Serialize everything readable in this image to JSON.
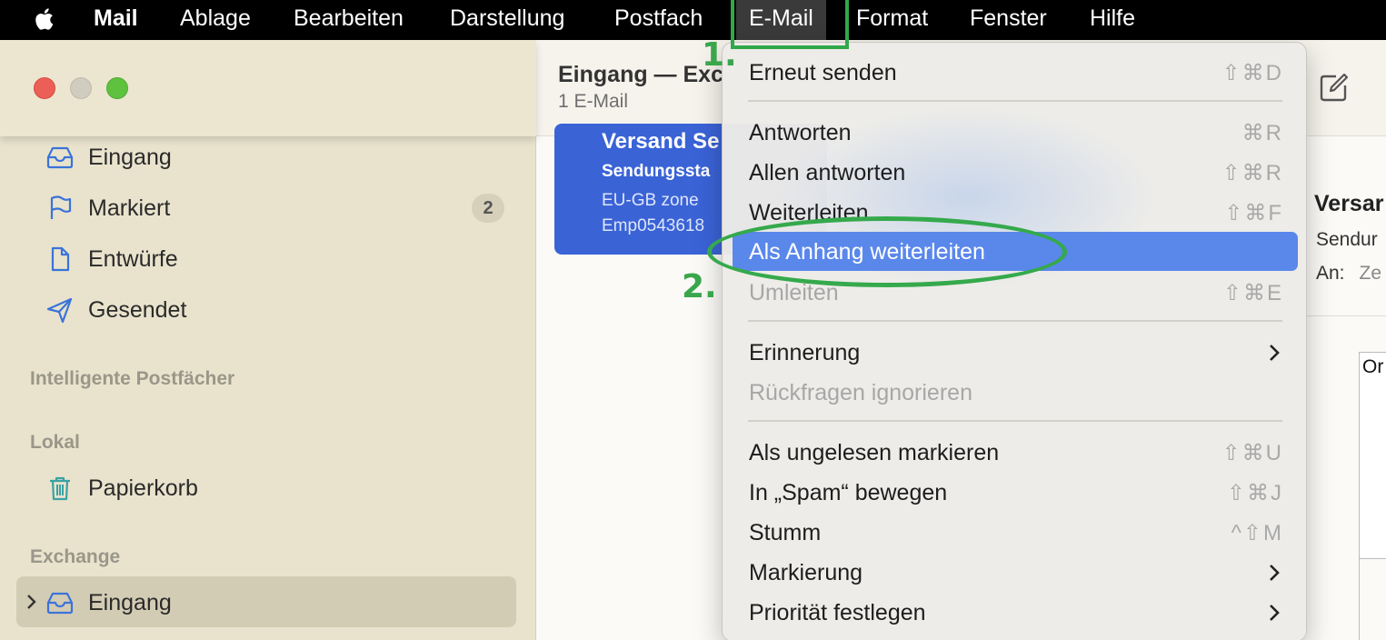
{
  "menubar": {
    "app": "Mail",
    "items": [
      "Ablage",
      "Bearbeiten",
      "Darstellung",
      "Postfach",
      "E-Mail",
      "Format",
      "Fenster",
      "Hilfe"
    ],
    "active": "E-Mail"
  },
  "annotations": {
    "step1": "1.",
    "step2": "2.",
    "accent": "#2fa84a"
  },
  "sidebar": {
    "items": [
      {
        "label": "Eingang",
        "icon": "inbox-icon"
      },
      {
        "label": "Markiert",
        "icon": "flag-icon",
        "badge": "2"
      },
      {
        "label": "Entwürfe",
        "icon": "document-icon"
      },
      {
        "label": "Gesendet",
        "icon": "paperplane-icon"
      }
    ],
    "sections": {
      "smart": "Intelligente Postfächer",
      "local": "Lokal",
      "exchange": "Exchange"
    },
    "local_items": [
      {
        "label": "Papierkorb",
        "icon": "trash-icon"
      }
    ],
    "exchange_items": [
      {
        "label": "Eingang",
        "icon": "inbox-icon"
      }
    ]
  },
  "header": {
    "title": "Eingang — Exc",
    "subtitle": "1 E-Mail"
  },
  "message": {
    "from": "Versand Se",
    "subject": "Sendungssta",
    "preview1": "EU-GB zone",
    "preview2": "Emp0543618",
    "color": "#3a63d6"
  },
  "reader": {
    "title": "Versar",
    "line": "Sendur",
    "to_label": "An:",
    "to_value": "Ze",
    "body": "Or"
  },
  "menu": {
    "groups": [
      [
        {
          "label": "Erneut senden",
          "shortcut": "⇧⌘D"
        }
      ],
      [
        {
          "label": "Antworten",
          "shortcut": "⌘R"
        },
        {
          "label": "Allen antworten",
          "shortcut": "⇧⌘R"
        },
        {
          "label": "Weiterleiten",
          "shortcut": "⇧⌘F"
        },
        {
          "label": "Als Anhang weiterleiten",
          "shortcut": "",
          "highlighted": true
        },
        {
          "label": "Umleiten",
          "shortcut": "⇧⌘E",
          "disabled": true
        }
      ],
      [
        {
          "label": "Erinnerung",
          "submenu": true
        },
        {
          "label": "Rückfragen ignorieren",
          "disabled": true
        }
      ],
      [
        {
          "label": "Als ungelesen markieren",
          "shortcut": "⇧⌘U"
        },
        {
          "label": "In „Spam“ bewegen",
          "shortcut": "⇧⌘J"
        },
        {
          "label": "Stumm",
          "shortcut": "^⇧M"
        },
        {
          "label": "Markierung",
          "submenu": true
        },
        {
          "label": "Priorität festlegen",
          "submenu": true
        }
      ]
    ],
    "highlight_color": "#5a87ea"
  }
}
